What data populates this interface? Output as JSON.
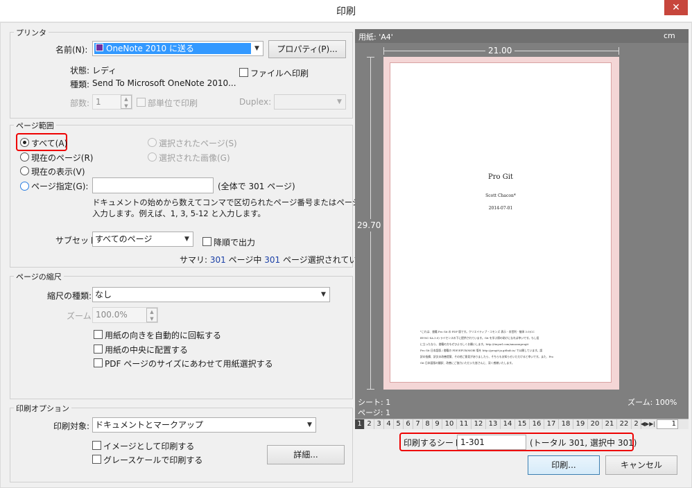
{
  "window": {
    "title": "印刷",
    "close": "✕"
  },
  "printer": {
    "group": "プリンタ",
    "name_label": "名前(N):",
    "name_value": "OneNote 2010 に送る",
    "properties": "プロパティ(P)...",
    "status_label": "状態:",
    "status_value": "レディ",
    "type_label": "種類:",
    "type_value": "Send To Microsoft OneNote 2010...",
    "print_to_file": "ファイルへ印刷",
    "copies_label": "部数:",
    "copies_value": "1",
    "collate": "部単位で印刷",
    "duplex_label": "Duplex:"
  },
  "range": {
    "group": "ページ範囲",
    "all": "すべて(A)",
    "current_page": "現在のページ(R)",
    "current_view": "現在の表示(V)",
    "page_spec": "ページ指定(G):",
    "selected_pages": "選択されたページ(S)",
    "selected_image": "選択された画像(G)",
    "total": "(全体で 301 ページ)",
    "help_line1": "ドキュメントの始めから数えてコンマで区切られたページ番号またはページ範囲を",
    "help_line2": "入力します。例えば、1, 3, 5-12 と入力します。",
    "subset_label": "サブセット:",
    "subset_value": "すべてのページ",
    "reverse": "降順で出力",
    "summary_prefix": "サマリ:",
    "summary_num1": "301",
    "summary_mid": "ページ中",
    "summary_num2": "301",
    "summary_suffix": "ページ選択されています"
  },
  "scale": {
    "group": "ページの縮尺",
    "type_label": "縮尺の種類:",
    "type_value": "なし",
    "zoom_label": "ズーム:",
    "zoom_value": "100.0%",
    "auto_rotate": "用紙の向きを自動的に回転する",
    "center": "用紙の中央に配置する",
    "pdf_size": "PDF ページのサイズにあわせて用紙選択する"
  },
  "options": {
    "group": "印刷オプション",
    "target_label": "印刷対象:",
    "target_value": "ドキュメントとマークアップ",
    "as_image": "イメージとして印刷する",
    "grayscale": "グレースケールで印刷する",
    "advanced": "詳細..."
  },
  "preview": {
    "paper": "用紙: 'A4'",
    "unit": "cm",
    "width": "21.00",
    "height": "29.70",
    "sheet": "シート: 1",
    "page": "ページ: 1",
    "zoom": "ズーム: 100%",
    "doc_title": "Pro Git",
    "doc_author": "Scott Chacon*",
    "doc_date": "2014-07-01",
    "foot1": "*これは、書籍 Pro Git の PDF 版です。クリエイティブ・コモンズ 表示 - 非営利 - 継承 3.0(CC",
    "foot2": "BY-NC-SA 3.0) ライセンスの下に提供されています。Git を学ぶ際の助けになれば幸いです。もし役",
    "foot3": "に立ったなら、書籍の方もぜひよろしくお願いします。http://tinyurl.com/amazonprogit",
    "foot4": "Pro Git 日本語版 / 書籍の PDF/EPUB/MOBI 版を http://progit-ja.github.io/ で公開しています。誤",
    "foot5": "訳の指摘、訳文の改善提案、その他ご意見がありましたら、そちらもお知らせいただけると幸いです。また、Pro",
    "foot6": "Git 日本語版の翻訳、改善にご協力いただいた皆さんに、深く感謝いたします。"
  },
  "pagebar": {
    "pages": [
      "1",
      "2",
      "3",
      "4",
      "5",
      "6",
      "7",
      "8",
      "9",
      "10",
      "11",
      "12",
      "13",
      "14",
      "15",
      "16",
      "17",
      "18",
      "19",
      "20",
      "21",
      "22",
      "2"
    ],
    "current": "1"
  },
  "sheets": {
    "label": "印刷するシート:",
    "value": "1-301",
    "info": "(トータル 301, 選択中 301)"
  },
  "buttons": {
    "print": "印刷...",
    "cancel": "キャンセル"
  }
}
